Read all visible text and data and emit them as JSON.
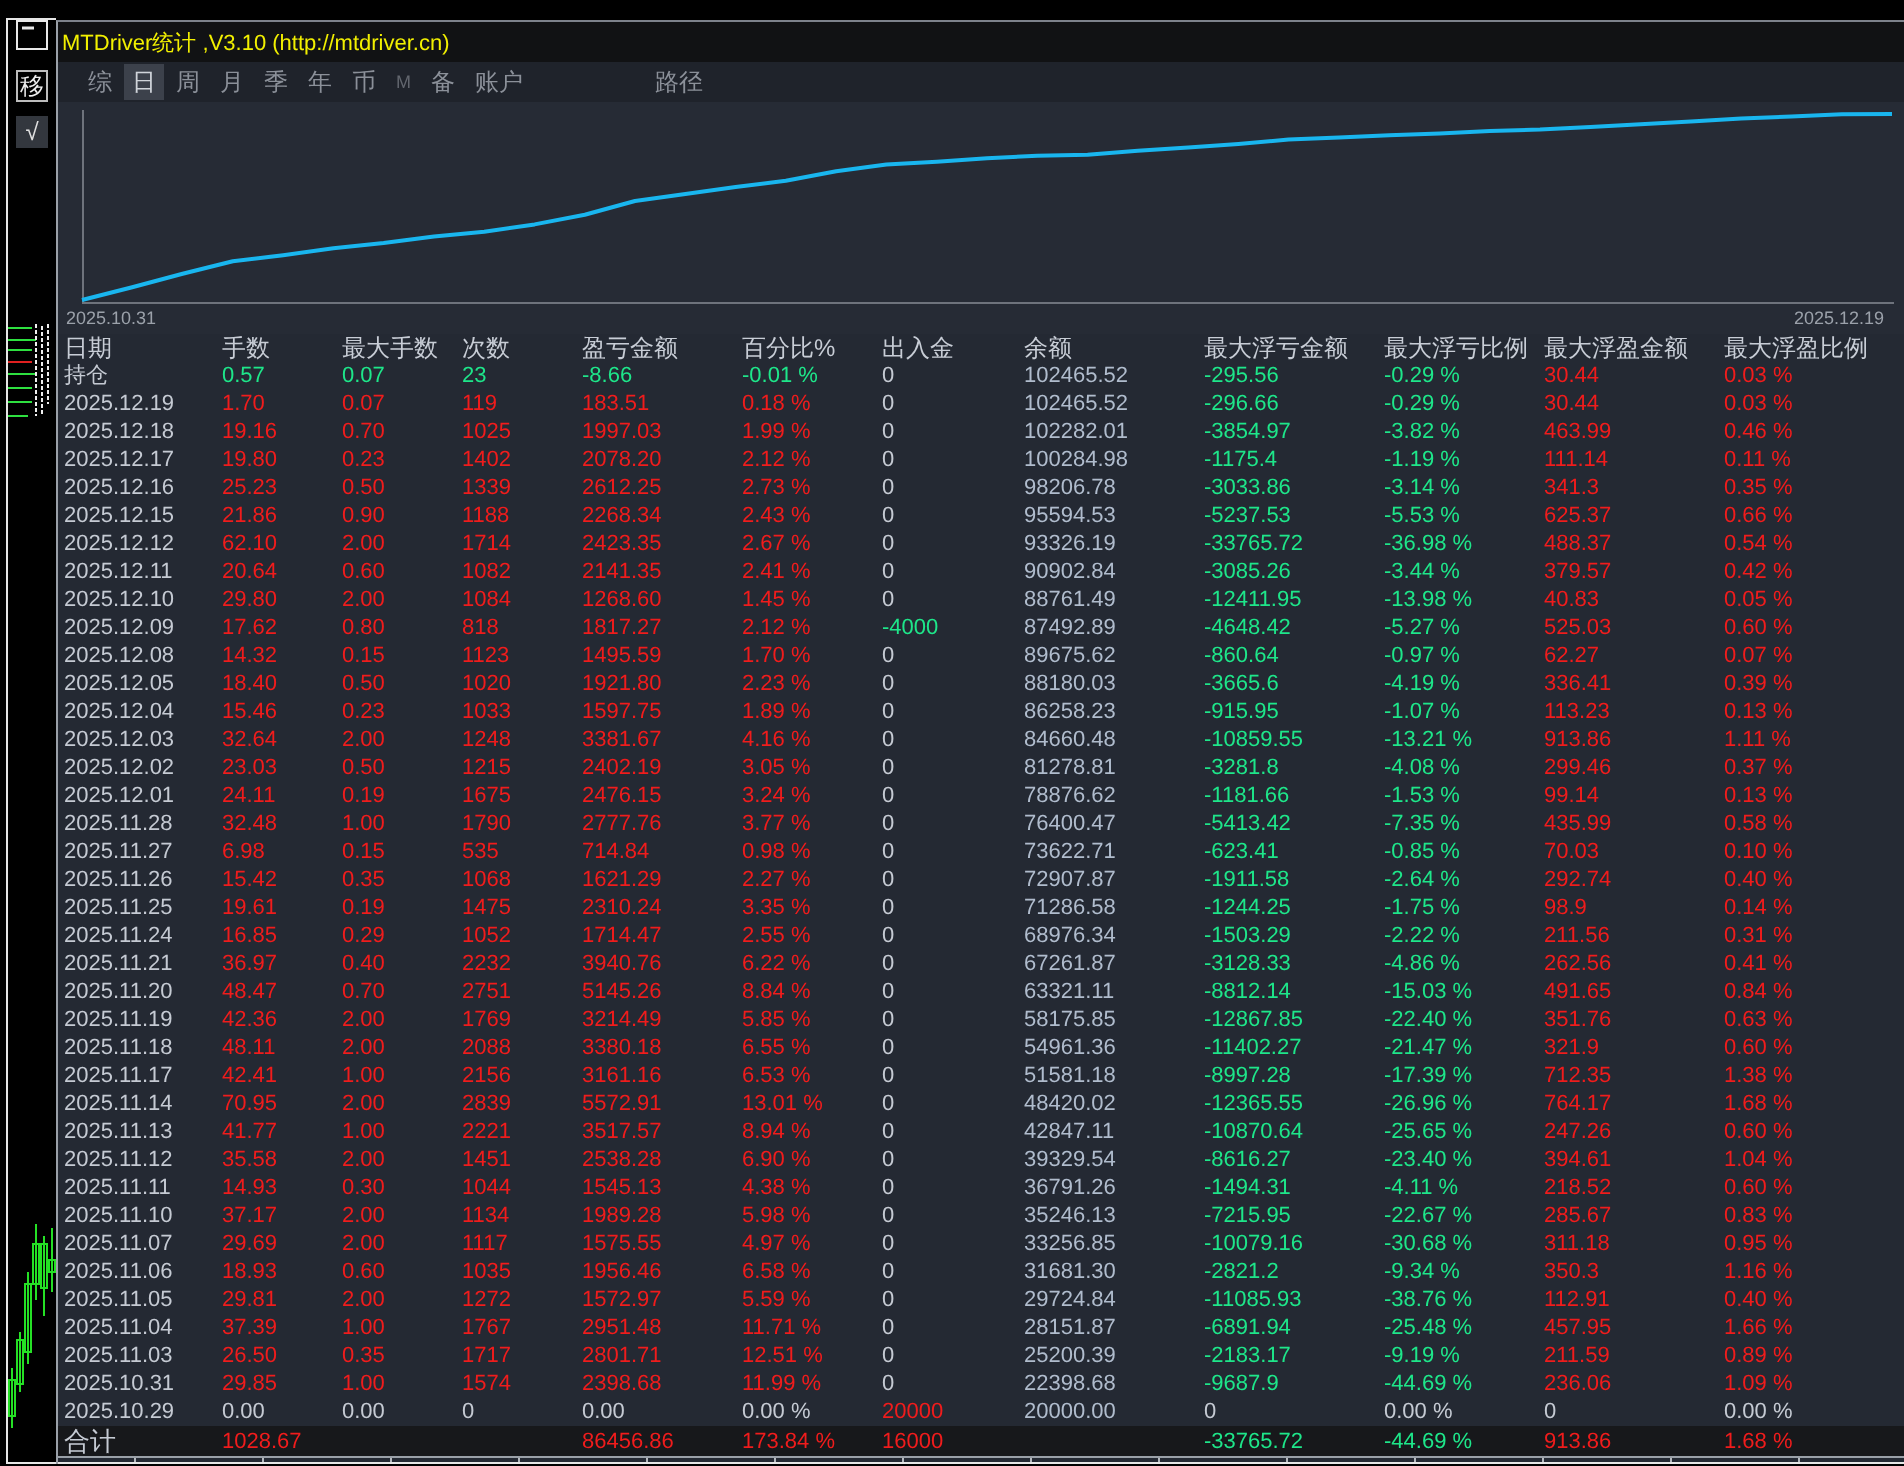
{
  "window": {
    "title": "MTDriver统计 ,V3.10 (http://mtdriver.cn)"
  },
  "side_buttons": [
    {
      "label": "移",
      "kind": "outlined"
    },
    {
      "label": "√",
      "kind": "filled"
    }
  ],
  "tabs": [
    {
      "label": "综",
      "selected": false,
      "disabled": false
    },
    {
      "label": "日",
      "selected": true,
      "disabled": false
    },
    {
      "label": "周",
      "selected": false,
      "disabled": false
    },
    {
      "label": "月",
      "selected": false,
      "disabled": false
    },
    {
      "label": "季",
      "selected": false,
      "disabled": false
    },
    {
      "label": "年",
      "selected": false,
      "disabled": false
    },
    {
      "label": "币",
      "selected": false,
      "disabled": false
    },
    {
      "label": "M",
      "selected": false,
      "disabled": true
    },
    {
      "label": "备",
      "selected": false,
      "disabled": false
    },
    {
      "label": "账户",
      "selected": false,
      "disabled": false
    }
  ],
  "path_tab": {
    "label": "路径",
    "selected": false
  },
  "chart": {
    "start_label": "2025.10.31",
    "end_label": "2025.12.19"
  },
  "table": {
    "columns": [
      "日期",
      "手数",
      "最大手数",
      "次数",
      "盈亏金额",
      "百分比%",
      "出入金",
      "余额",
      "最大浮亏金额",
      "最大浮亏比例",
      "最大浮盈金额",
      "最大浮盈比例"
    ],
    "rows": [
      {
        "kind": "loss",
        "deposit": false,
        "withdrawal": false,
        "cells": [
          "持仓",
          "0.57",
          "0.07",
          "23",
          "-8.66",
          "-0.01 %",
          "0",
          "102465.52",
          "-295.56",
          "-0.29 %",
          "30.44",
          "0.03 %"
        ]
      },
      {
        "kind": "profit",
        "deposit": false,
        "withdrawal": false,
        "cells": [
          "2025.12.19",
          "1.70",
          "0.07",
          "119",
          "183.51",
          "0.18 %",
          "0",
          "102465.52",
          "-296.66",
          "-0.29 %",
          "30.44",
          "0.03 %"
        ]
      },
      {
        "kind": "profit",
        "deposit": false,
        "withdrawal": false,
        "cells": [
          "2025.12.18",
          "19.16",
          "0.70",
          "1025",
          "1997.03",
          "1.99 %",
          "0",
          "102282.01",
          "-3854.97",
          "-3.82 %",
          "463.99",
          "0.46 %"
        ]
      },
      {
        "kind": "profit",
        "deposit": false,
        "withdrawal": false,
        "cells": [
          "2025.12.17",
          "19.80",
          "0.23",
          "1402",
          "2078.20",
          "2.12 %",
          "0",
          "100284.98",
          "-1175.4",
          "-1.19 %",
          "111.14",
          "0.11 %"
        ]
      },
      {
        "kind": "profit",
        "deposit": false,
        "withdrawal": false,
        "cells": [
          "2025.12.16",
          "25.23",
          "0.50",
          "1339",
          "2612.25",
          "2.73 %",
          "0",
          "98206.78",
          "-3033.86",
          "-3.14 %",
          "341.3",
          "0.35 %"
        ]
      },
      {
        "kind": "profit",
        "deposit": false,
        "withdrawal": false,
        "cells": [
          "2025.12.15",
          "21.86",
          "0.90",
          "1188",
          "2268.34",
          "2.43 %",
          "0",
          "95594.53",
          "-5237.53",
          "-5.53 %",
          "625.37",
          "0.66 %"
        ]
      },
      {
        "kind": "profit",
        "deposit": false,
        "withdrawal": false,
        "cells": [
          "2025.12.12",
          "62.10",
          "2.00",
          "1714",
          "2423.35",
          "2.67 %",
          "0",
          "93326.19",
          "-33765.72",
          "-36.98 %",
          "488.37",
          "0.54 %"
        ]
      },
      {
        "kind": "profit",
        "deposit": false,
        "withdrawal": false,
        "cells": [
          "2025.12.11",
          "20.64",
          "0.60",
          "1082",
          "2141.35",
          "2.41 %",
          "0",
          "90902.84",
          "-3085.26",
          "-3.44 %",
          "379.57",
          "0.42 %"
        ]
      },
      {
        "kind": "profit",
        "deposit": false,
        "withdrawal": false,
        "cells": [
          "2025.12.10",
          "29.80",
          "2.00",
          "1084",
          "1268.60",
          "1.45 %",
          "0",
          "88761.49",
          "-12411.95",
          "-13.98 %",
          "40.83",
          "0.05 %"
        ]
      },
      {
        "kind": "profit",
        "deposit": false,
        "withdrawal": true,
        "cells": [
          "2025.12.09",
          "17.62",
          "0.80",
          "818",
          "1817.27",
          "2.12 %",
          "-4000",
          "87492.89",
          "-4648.42",
          "-5.27 %",
          "525.03",
          "0.60 %"
        ]
      },
      {
        "kind": "profit",
        "deposit": false,
        "withdrawal": false,
        "cells": [
          "2025.12.08",
          "14.32",
          "0.15",
          "1123",
          "1495.59",
          "1.70 %",
          "0",
          "89675.62",
          "-860.64",
          "-0.97 %",
          "62.27",
          "0.07 %"
        ]
      },
      {
        "kind": "profit",
        "deposit": false,
        "withdrawal": false,
        "cells": [
          "2025.12.05",
          "18.40",
          "0.50",
          "1020",
          "1921.80",
          "2.23 %",
          "0",
          "88180.03",
          "-3665.6",
          "-4.19 %",
          "336.41",
          "0.39 %"
        ]
      },
      {
        "kind": "profit",
        "deposit": false,
        "withdrawal": false,
        "cells": [
          "2025.12.04",
          "15.46",
          "0.23",
          "1033",
          "1597.75",
          "1.89 %",
          "0",
          "86258.23",
          "-915.95",
          "-1.07 %",
          "113.23",
          "0.13 %"
        ]
      },
      {
        "kind": "profit",
        "deposit": false,
        "withdrawal": false,
        "cells": [
          "2025.12.03",
          "32.64",
          "2.00",
          "1248",
          "3381.67",
          "4.16 %",
          "0",
          "84660.48",
          "-10859.55",
          "-13.21 %",
          "913.86",
          "1.11 %"
        ]
      },
      {
        "kind": "profit",
        "deposit": false,
        "withdrawal": false,
        "cells": [
          "2025.12.02",
          "23.03",
          "0.50",
          "1215",
          "2402.19",
          "3.05 %",
          "0",
          "81278.81",
          "-3281.8",
          "-4.08 %",
          "299.46",
          "0.37 %"
        ]
      },
      {
        "kind": "profit",
        "deposit": false,
        "withdrawal": false,
        "cells": [
          "2025.12.01",
          "24.11",
          "0.19",
          "1675",
          "2476.15",
          "3.24 %",
          "0",
          "78876.62",
          "-1181.66",
          "-1.53 %",
          "99.14",
          "0.13 %"
        ]
      },
      {
        "kind": "profit",
        "deposit": false,
        "withdrawal": false,
        "cells": [
          "2025.11.28",
          "32.48",
          "1.00",
          "1790",
          "2777.76",
          "3.77 %",
          "0",
          "76400.47",
          "-5413.42",
          "-7.35 %",
          "435.99",
          "0.58 %"
        ]
      },
      {
        "kind": "profit",
        "deposit": false,
        "withdrawal": false,
        "cells": [
          "2025.11.27",
          "6.98",
          "0.15",
          "535",
          "714.84",
          "0.98 %",
          "0",
          "73622.71",
          "-623.41",
          "-0.85 %",
          "70.03",
          "0.10 %"
        ]
      },
      {
        "kind": "profit",
        "deposit": false,
        "withdrawal": false,
        "cells": [
          "2025.11.26",
          "15.42",
          "0.35",
          "1068",
          "1621.29",
          "2.27 %",
          "0",
          "72907.87",
          "-1911.58",
          "-2.64 %",
          "292.74",
          "0.40 %"
        ]
      },
      {
        "kind": "profit",
        "deposit": false,
        "withdrawal": false,
        "cells": [
          "2025.11.25",
          "19.61",
          "0.19",
          "1475",
          "2310.24",
          "3.35 %",
          "0",
          "71286.58",
          "-1244.25",
          "-1.75 %",
          "98.9",
          "0.14 %"
        ]
      },
      {
        "kind": "profit",
        "deposit": false,
        "withdrawal": false,
        "cells": [
          "2025.11.24",
          "16.85",
          "0.29",
          "1052",
          "1714.47",
          "2.55 %",
          "0",
          "68976.34",
          "-1503.29",
          "-2.22 %",
          "211.56",
          "0.31 %"
        ]
      },
      {
        "kind": "profit",
        "deposit": false,
        "withdrawal": false,
        "cells": [
          "2025.11.21",
          "36.97",
          "0.40",
          "2232",
          "3940.76",
          "6.22 %",
          "0",
          "67261.87",
          "-3128.33",
          "-4.86 %",
          "262.56",
          "0.41 %"
        ]
      },
      {
        "kind": "profit",
        "deposit": false,
        "withdrawal": false,
        "cells": [
          "2025.11.20",
          "48.47",
          "0.70",
          "2751",
          "5145.26",
          "8.84 %",
          "0",
          "63321.11",
          "-8812.14",
          "-15.03 %",
          "491.65",
          "0.84 %"
        ]
      },
      {
        "kind": "profit",
        "deposit": false,
        "withdrawal": false,
        "cells": [
          "2025.11.19",
          "42.36",
          "2.00",
          "1769",
          "3214.49",
          "5.85 %",
          "0",
          "58175.85",
          "-12867.85",
          "-22.40 %",
          "351.76",
          "0.63 %"
        ]
      },
      {
        "kind": "profit",
        "deposit": false,
        "withdrawal": false,
        "cells": [
          "2025.11.18",
          "48.11",
          "2.00",
          "2088",
          "3380.18",
          "6.55 %",
          "0",
          "54961.36",
          "-11402.27",
          "-21.47 %",
          "321.9",
          "0.60 %"
        ]
      },
      {
        "kind": "profit",
        "deposit": false,
        "withdrawal": false,
        "cells": [
          "2025.11.17",
          "42.41",
          "1.00",
          "2156",
          "3161.16",
          "6.53 %",
          "0",
          "51581.18",
          "-8997.28",
          "-17.39 %",
          "712.35",
          "1.38 %"
        ]
      },
      {
        "kind": "profit",
        "deposit": false,
        "withdrawal": false,
        "cells": [
          "2025.11.14",
          "70.95",
          "2.00",
          "2839",
          "5572.91",
          "13.01 %",
          "0",
          "48420.02",
          "-12365.55",
          "-26.96 %",
          "764.17",
          "1.68 %"
        ]
      },
      {
        "kind": "profit",
        "deposit": false,
        "withdrawal": false,
        "cells": [
          "2025.11.13",
          "41.77",
          "1.00",
          "2221",
          "3517.57",
          "8.94 %",
          "0",
          "42847.11",
          "-10870.64",
          "-25.65 %",
          "247.26",
          "0.60 %"
        ]
      },
      {
        "kind": "profit",
        "deposit": false,
        "withdrawal": false,
        "cells": [
          "2025.11.12",
          "35.58",
          "2.00",
          "1451",
          "2538.28",
          "6.90 %",
          "0",
          "39329.54",
          "-8616.27",
          "-23.40 %",
          "394.61",
          "1.04 %"
        ]
      },
      {
        "kind": "profit",
        "deposit": false,
        "withdrawal": false,
        "cells": [
          "2025.11.11",
          "14.93",
          "0.30",
          "1044",
          "1545.13",
          "4.38 %",
          "0",
          "36791.26",
          "-1494.31",
          "-4.11 %",
          "218.52",
          "0.60 %"
        ]
      },
      {
        "kind": "profit",
        "deposit": false,
        "withdrawal": false,
        "cells": [
          "2025.11.10",
          "37.17",
          "2.00",
          "1134",
          "1989.28",
          "5.98 %",
          "0",
          "35246.13",
          "-7215.95",
          "-22.67 %",
          "285.67",
          "0.83 %"
        ]
      },
      {
        "kind": "profit",
        "deposit": false,
        "withdrawal": false,
        "cells": [
          "2025.11.07",
          "29.69",
          "2.00",
          "1117",
          "1575.55",
          "4.97 %",
          "0",
          "33256.85",
          "-10079.16",
          "-30.68 %",
          "311.18",
          "0.95 %"
        ]
      },
      {
        "kind": "profit",
        "deposit": false,
        "withdrawal": false,
        "cells": [
          "2025.11.06",
          "18.93",
          "0.60",
          "1035",
          "1956.46",
          "6.58 %",
          "0",
          "31681.30",
          "-2821.2",
          "-9.34 %",
          "350.3",
          "1.16 %"
        ]
      },
      {
        "kind": "profit",
        "deposit": false,
        "withdrawal": false,
        "cells": [
          "2025.11.05",
          "29.81",
          "2.00",
          "1272",
          "1572.97",
          "5.59 %",
          "0",
          "29724.84",
          "-11085.93",
          "-38.76 %",
          "112.91",
          "0.40 %"
        ]
      },
      {
        "kind": "profit",
        "deposit": false,
        "withdrawal": false,
        "cells": [
          "2025.11.04",
          "37.39",
          "1.00",
          "1767",
          "2951.48",
          "11.71 %",
          "0",
          "28151.87",
          "-6891.94",
          "-25.48 %",
          "457.95",
          "1.66 %"
        ]
      },
      {
        "kind": "profit",
        "deposit": false,
        "withdrawal": false,
        "cells": [
          "2025.11.03",
          "26.50",
          "0.35",
          "1717",
          "2801.71",
          "12.51 %",
          "0",
          "25200.39",
          "-2183.17",
          "-9.19 %",
          "211.59",
          "0.89 %"
        ]
      },
      {
        "kind": "profit",
        "deposit": false,
        "withdrawal": false,
        "cells": [
          "2025.10.31",
          "29.85",
          "1.00",
          "1574",
          "2398.68",
          "11.99 %",
          "0",
          "22398.68",
          "-9687.9",
          "-44.69 %",
          "236.06",
          "1.09 %"
        ]
      },
      {
        "kind": "start",
        "deposit": true,
        "withdrawal": false,
        "cells": [
          "2025.10.29",
          "0.00",
          "0.00",
          "0",
          "0.00",
          "0.00 %",
          "20000",
          "20000.00",
          "0",
          "0.00 %",
          "0",
          "0.00 %"
        ]
      },
      {
        "kind": "total",
        "deposit": true,
        "withdrawal": false,
        "cells": [
          "合计",
          "1028.67",
          "",
          "",
          "86456.86",
          "173.84 %",
          "16000",
          "",
          "-33765.72",
          "-44.69 %",
          "913.86",
          "1.68 %"
        ]
      }
    ]
  }
}
